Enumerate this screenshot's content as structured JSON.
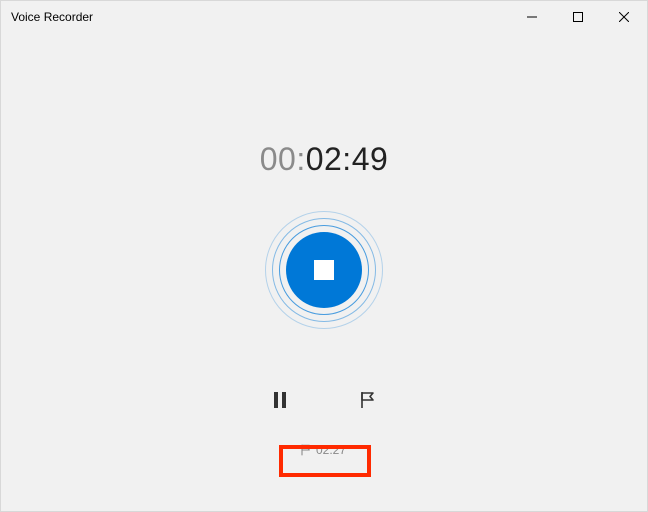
{
  "window": {
    "title": "Voice Recorder"
  },
  "timer": {
    "hours": "00:",
    "rest": "02:49"
  },
  "marker": {
    "time": "02:27"
  }
}
